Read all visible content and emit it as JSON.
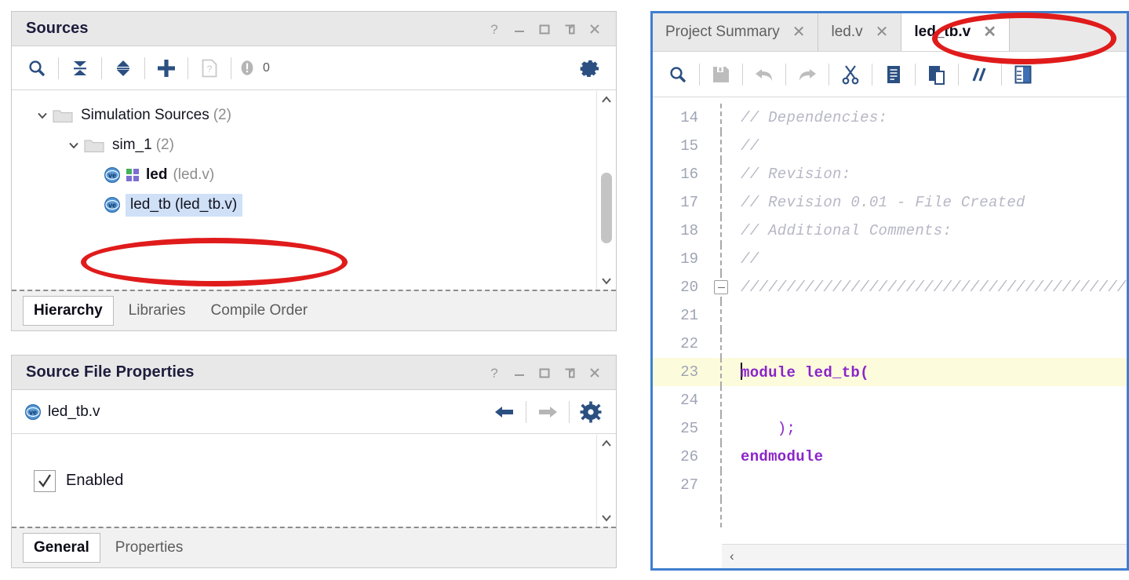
{
  "sources_panel": {
    "title": "Sources",
    "window_buttons": [
      {
        "name": "help",
        "glyph": "?"
      },
      {
        "name": "minimize",
        "glyph": "—"
      },
      {
        "name": "maximize",
        "glyph": "□"
      },
      {
        "name": "float",
        "glyph": "⧉"
      },
      {
        "name": "close",
        "glyph": "✕"
      }
    ],
    "toolbar": {
      "search_icon": "search-icon",
      "collapse_all_icon": "collapse-all-icon",
      "expand_all_icon": "expand-all-icon",
      "add_sources_icon": "plus-icon",
      "report_icon": "report-file-icon",
      "warning_icon": "warning-icon",
      "warning_count": "0",
      "settings_icon": "gear-icon"
    },
    "tree": [
      {
        "label": "Simulation Sources",
        "count": "(2)",
        "indent": 0,
        "expanded": true,
        "icon": "folder-icon",
        "type": "folder"
      },
      {
        "label": "sim_1",
        "count": "(2)",
        "indent": 1,
        "expanded": true,
        "icon": "folder-icon",
        "type": "folder"
      },
      {
        "label": "led",
        "file": "(led.v)",
        "indent": 2,
        "icon": "verilog-icon",
        "extra_icon": "module-icon",
        "type": "file",
        "selected": false
      },
      {
        "label": "led_tb (led_tb.v)",
        "indent": 2,
        "icon": "verilog-icon",
        "type": "file",
        "selected": true
      }
    ],
    "tabs": [
      {
        "label": "Hierarchy",
        "active": true
      },
      {
        "label": "Libraries",
        "active": false
      },
      {
        "label": "Compile Order",
        "active": false
      }
    ],
    "scrollbar": {
      "up_glyph": "⌃",
      "down_glyph": "⌄"
    }
  },
  "properties_panel": {
    "title": "Source File Properties",
    "window_buttons": [
      {
        "name": "help",
        "glyph": "?"
      },
      {
        "name": "minimize",
        "glyph": "—"
      },
      {
        "name": "maximize",
        "glyph": "□"
      },
      {
        "name": "float",
        "glyph": "⧉"
      },
      {
        "name": "close",
        "glyph": "✕"
      }
    ],
    "file_name": "led_tb.v",
    "file_icon": "verilog-icon",
    "nav": {
      "back_icon": "arrow-left-icon",
      "forward_icon": "arrow-right-icon",
      "settings_icon": "gear-icon"
    },
    "enabled_checkbox": {
      "label": "Enabled",
      "checked": true
    },
    "tabs": [
      {
        "label": "General",
        "active": true
      },
      {
        "label": "Properties",
        "active": false
      }
    ],
    "scrollbar": {
      "up_glyph": "⌃",
      "down_glyph": "⌄"
    }
  },
  "editor_panel": {
    "tabs": [
      {
        "label": "Project Summary",
        "active": false,
        "close": "✕"
      },
      {
        "label": "led.v",
        "active": false,
        "close": "✕"
      },
      {
        "label": "led_tb.v",
        "active": true,
        "close": "✕"
      }
    ],
    "toolbar_icons": [
      "search-icon",
      "save-icon",
      "undo-icon",
      "redo-icon",
      "cut-icon",
      "copy-icon",
      "paste-icon",
      "comment-icon",
      "column-icon"
    ],
    "code": [
      {
        "num": "14",
        "text": "// Dependencies:",
        "style": "cmt",
        "fold": false,
        "hl": false
      },
      {
        "num": "15",
        "text": "//",
        "style": "cmt",
        "fold": false,
        "hl": false
      },
      {
        "num": "16",
        "text": "// Revision:",
        "style": "cmt",
        "fold": false,
        "hl": false
      },
      {
        "num": "17",
        "text": "// Revision 0.01 - File Created",
        "style": "cmt",
        "fold": false,
        "hl": false
      },
      {
        "num": "18",
        "text": "// Additional Comments:",
        "style": "cmt",
        "fold": false,
        "hl": false
      },
      {
        "num": "19",
        "text": "//",
        "style": "cmt",
        "fold": false,
        "hl": false
      },
      {
        "num": "20",
        "text": "//////////////////////////////////////////",
        "style": "cmt",
        "fold": true,
        "hl": false
      },
      {
        "num": "21",
        "text": "",
        "style": "cmt",
        "fold": false,
        "hl": false
      },
      {
        "num": "22",
        "text": "",
        "style": "cmt",
        "fold": false,
        "hl": false
      },
      {
        "num": "23",
        "text": "module led_tb(",
        "style": "code",
        "fold": false,
        "hl": true,
        "caret": true
      },
      {
        "num": "24",
        "text": "",
        "style": "code",
        "fold": false,
        "hl": false
      },
      {
        "num": "25",
        "text": "    );",
        "style": "punct",
        "fold": false,
        "hl": false
      },
      {
        "num": "26",
        "text": "endmodule",
        "style": "kw",
        "fold": false,
        "hl": false
      },
      {
        "num": "27",
        "text": "",
        "style": "code",
        "fold": false,
        "hl": false
      }
    ],
    "hscroll_left_glyph": "‹"
  },
  "annotations": {
    "ellipse_tree": {
      "note": "red-ellipse-around-led_tb-tree-item"
    },
    "ellipse_tab": {
      "note": "red-ellipse-around-led_tb.v-tab"
    },
    "color": "#e01b1b"
  },
  "colors": {
    "accent_blue": "#3f7fd0",
    "icon_blue": "#2b4f81",
    "selection_blue": "#cfe0f7",
    "highlight_yellow": "#fcfbdc",
    "annotation_red": "#e01b1b",
    "panel_header_gray": "#e8e8e8"
  }
}
